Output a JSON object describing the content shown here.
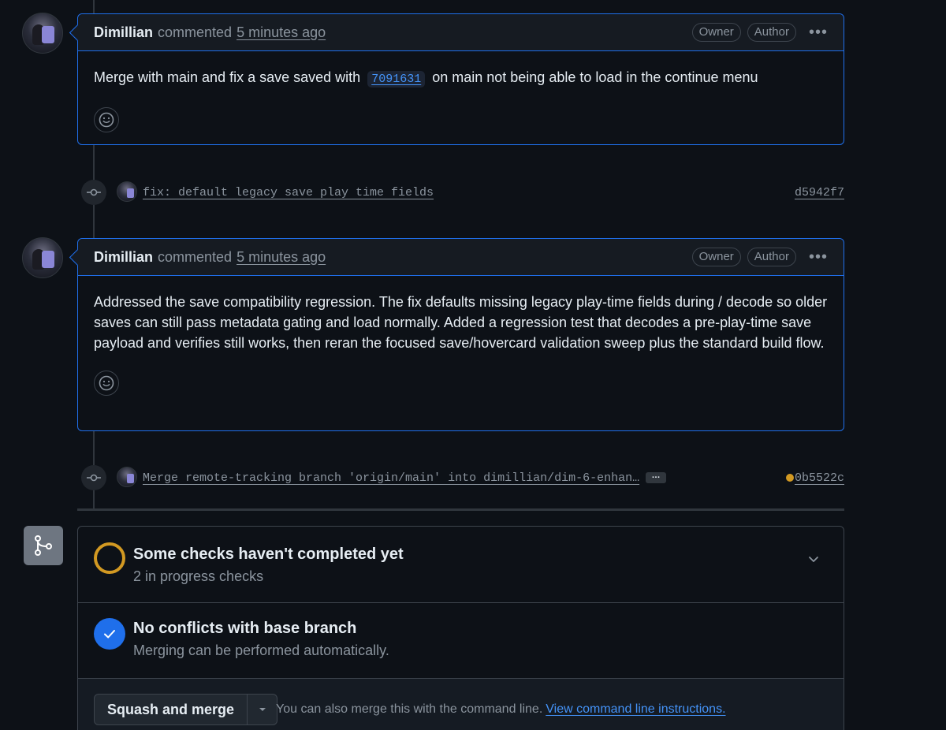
{
  "comments": [
    {
      "author": "Dimillian",
      "verb": "commented",
      "time": "5 minutes ago",
      "badges": [
        "Owner",
        "Author"
      ],
      "body_before": "Merge with main and fix a save saved with",
      "body_code": "7091631",
      "body_after": "on main not being able to load in the continue menu"
    },
    {
      "author": "Dimillian",
      "verb": "commented",
      "time": "5 minutes ago",
      "badges": [
        "Owner",
        "Author"
      ],
      "body": "Addressed the save compatibility regression. The fix defaults missing legacy play-time fields during / decode so older saves can still pass metadata gating and load normally. Added a regression test that decodes a pre-play-time save payload and verifies still works, then reran the focused save/hovercard validation sweep plus the standard build flow."
    }
  ],
  "commits": [
    {
      "message": "fix: default legacy save play time fields",
      "sha": "d5942f7"
    },
    {
      "message": "Merge remote-tracking branch 'origin/main' into dimillian/dim-6-enhan…",
      "sha": "0b5522c",
      "ellipsis": "…",
      "status_color": "#d29922"
    }
  ],
  "merge": {
    "checks_title": "Some checks haven't completed yet",
    "checks_sub": "2 in progress checks",
    "conflicts_title": "No conflicts with base branch",
    "conflicts_sub": "Merging can be performed automatically.",
    "button_label": "Squash and merge",
    "cmd_text": "You can also merge this with the command line.",
    "cmd_link": "View command line instructions."
  },
  "colors": {
    "accent_blue": "#1f6feb",
    "link_blue": "#4493f8",
    "pending_yellow": "#d29922",
    "background": "#0d1117"
  },
  "icons": [
    "smiley-icon",
    "git-commit-icon",
    "git-merge-icon",
    "chevron-down-icon",
    "check-icon",
    "kebab-horizontal-icon",
    "triangle-down-icon"
  ]
}
